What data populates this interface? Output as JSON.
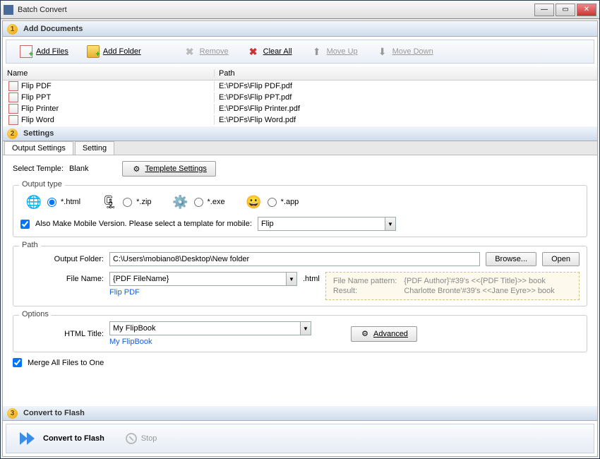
{
  "window": {
    "title": "Batch Convert"
  },
  "sections": {
    "add": {
      "num": "1",
      "title": "Add Documents"
    },
    "settings": {
      "num": "2",
      "title": "Settings"
    },
    "convert": {
      "num": "3",
      "title": "Convert to Flash"
    }
  },
  "toolbar": {
    "add_files": "Add Files",
    "add_folder": "Add Folder",
    "remove": "Remove",
    "clear_all": "Clear All",
    "move_up": "Move Up",
    "move_down": "Move Down"
  },
  "table": {
    "col_name": "Name",
    "col_path": "Path",
    "rows": [
      {
        "name": "Flip PDF",
        "path": "E:\\PDFs\\Flip PDF.pdf"
      },
      {
        "name": "Flip PPT",
        "path": "E:\\PDFs\\Flip PPT.pdf"
      },
      {
        "name": "Flip Printer",
        "path": "E:\\PDFs\\Flip Printer.pdf"
      },
      {
        "name": "Flip Word",
        "path": "E:\\PDFs\\Flip Word.pdf"
      }
    ]
  },
  "tabs": {
    "output": "Output Settings",
    "setting": "Setting"
  },
  "settings": {
    "select_temple_label": "Select Temple:",
    "select_temple_value": "Blank",
    "templete_settings_btn": "Templete Settings",
    "output_type_legend": "Output type",
    "types": {
      "html": "*.html",
      "zip": "*.zip",
      "exe": "*.exe",
      "app": "*.app"
    },
    "mobile_label": "Also Make Mobile Version. Please select a template for mobile:",
    "mobile_template": "Flip",
    "path_legend": "Path",
    "output_folder_label": "Output Folder:",
    "output_folder_value": "C:\\Users\\mobiano8\\Desktop\\New folder",
    "browse_btn": "Browse...",
    "open_btn": "Open",
    "file_name_label": "File Name:",
    "file_name_value": "{PDF FileName}",
    "file_ext": ".html",
    "file_name_hint": "Flip PDF",
    "pattern_label": "File Name pattern:",
    "pattern_value": "{PDF Author}'#39's <<{PDF Title}>> book",
    "result_label": "Result:",
    "result_value": "Charlotte Bronte'#39's <<Jane Eyre>> book",
    "options_legend": "Options",
    "html_title_label": "HTML Title:",
    "html_title_value": "My FlipBook",
    "html_title_hint": "My FlipBook",
    "advanced_btn": "Advanced",
    "merge_label": "Merge All Files to One"
  },
  "convert": {
    "convert_btn": "Convert to Flash",
    "stop_btn": "Stop"
  }
}
